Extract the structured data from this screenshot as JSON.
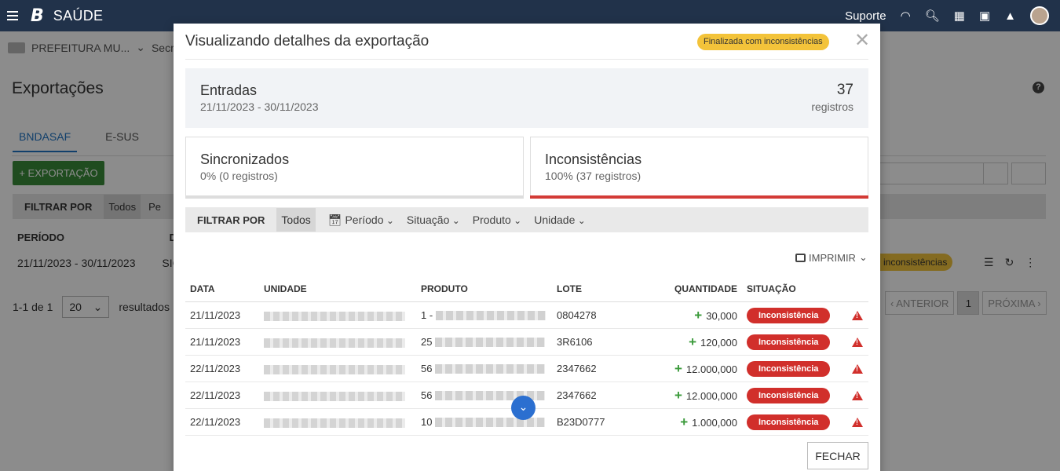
{
  "topbar": {
    "app_name": "SAÚDE",
    "support": "Suporte"
  },
  "background": {
    "breadcrumb": [
      "PREFEITURA MU...",
      "Secre"
    ],
    "page_title": "Exportações",
    "tabs": [
      "BNDASAF",
      "E-SUS"
    ],
    "export_button": "+ EXPORTAÇÃO",
    "filter_label": "FILTRAR POR",
    "filter_selected": "Todos",
    "filter_next": "Pe",
    "columns": [
      "PERÍODO",
      "DES"
    ],
    "row": {
      "period": "21/11/2023 - 30/11/2023",
      "desc": "SIG",
      "badge": "inconsistências"
    },
    "pager": {
      "info": "1-1 de 1",
      "page_size": "20",
      "results": "resultados",
      "prev": "‹ ANTERIOR",
      "current": "1",
      "next": "PRÓXIMA ›"
    }
  },
  "modal": {
    "title": "Visualizando detalhes da exportação",
    "status": "Finalizada com inconsistências",
    "summary": {
      "title": "Entradas",
      "range": "21/11/2023 - 30/11/2023",
      "count": "37",
      "unit": "registros"
    },
    "cards": [
      {
        "title": "Sincronizados",
        "sub": "0% (0 registros)",
        "fill_pct": 0
      },
      {
        "title": "Inconsistências",
        "sub": "100% (37 registros)",
        "fill_pct": 100
      }
    ],
    "filter": {
      "label": "FILTRAR POR",
      "selected": "Todos",
      "options": [
        "Período",
        "Situação",
        "Produto",
        "Unidade"
      ]
    },
    "print_label": "IMPRIMIR",
    "columns": {
      "date": "DATA",
      "unit": "UNIDADE",
      "product": "PRODUTO",
      "lote": "LOTE",
      "qty": "QUANTIDADE",
      "sit": "SITUAÇÃO"
    },
    "rows": [
      {
        "date": "21/11/2023",
        "product_prefix": "1 -",
        "lote": "0804278",
        "qty": "30,000",
        "sit": "Inconsistência"
      },
      {
        "date": "21/11/2023",
        "product_prefix": "25",
        "lote": "3R6106",
        "qty": "120,000",
        "sit": "Inconsistência"
      },
      {
        "date": "22/11/2023",
        "product_prefix": "56",
        "lote": "2347662",
        "qty": "12.000,000",
        "sit": "Inconsistência"
      },
      {
        "date": "22/11/2023",
        "product_prefix": "56",
        "lote": "2347662",
        "qty": "12.000,000",
        "sit": "Inconsistência"
      },
      {
        "date": "22/11/2023",
        "product_prefix": "10",
        "lote": "B23D0777",
        "qty": "1.000,000",
        "sit": "Inconsistência"
      }
    ],
    "close_button": "FECHAR"
  }
}
